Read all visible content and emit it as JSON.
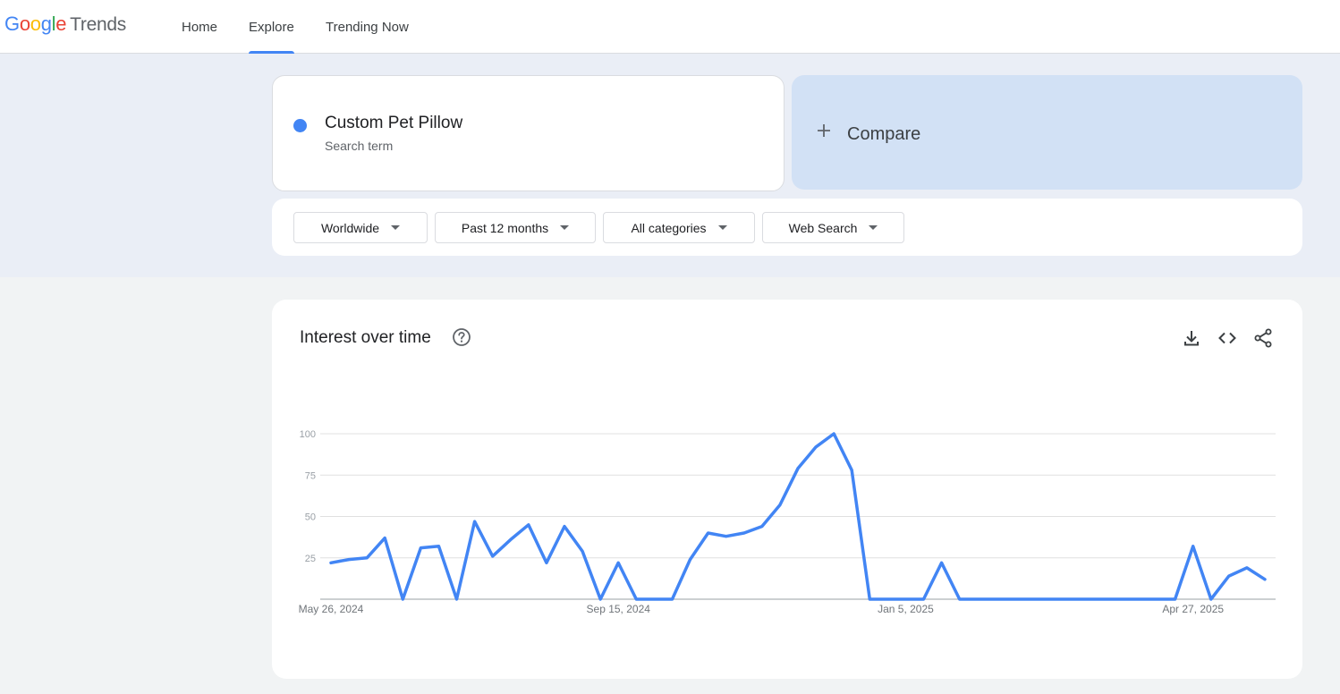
{
  "header": {
    "logo_google": "Google",
    "logo_trends": "Trends",
    "nav": [
      {
        "label": "Home"
      },
      {
        "label": "Explore"
      },
      {
        "label": "Trending Now"
      }
    ]
  },
  "search_term": {
    "name": "Custom Pet Pillow",
    "sub": "Search term",
    "color": "#4285f4"
  },
  "compare": {
    "label": "Compare"
  },
  "filters": {
    "region": "Worldwide",
    "time": "Past 12 months",
    "category": "All categories",
    "source": "Web Search"
  },
  "chart_section": {
    "title": "Interest over time",
    "icons": [
      "help-icon",
      "download-icon",
      "embed-icon",
      "share-icon"
    ]
  },
  "chart_data": {
    "type": "line",
    "title": "Interest over time",
    "xlabel": "",
    "ylabel": "",
    "ylim": [
      0,
      100
    ],
    "yticks": [
      25,
      50,
      75,
      100
    ],
    "x_tick_labels": [
      {
        "label": "May 26, 2024",
        "index": 0
      },
      {
        "label": "Sep 15, 2024",
        "index": 16
      },
      {
        "label": "Jan 5, 2025",
        "index": 32
      },
      {
        "label": "Apr 27, 2025",
        "index": 48
      }
    ],
    "grid": true,
    "series": [
      {
        "color": "#4285f4",
        "values": [
          22,
          24,
          25,
          37,
          0,
          31,
          32,
          0,
          47,
          26,
          36,
          45,
          22,
          44,
          29,
          0,
          22,
          0,
          0,
          0,
          24,
          40,
          38,
          40,
          44,
          57,
          79,
          92,
          100,
          78,
          0,
          0,
          0,
          0,
          22,
          0,
          0,
          0,
          0,
          0,
          0,
          0,
          0,
          0,
          0,
          0,
          0,
          0,
          32,
          0,
          14,
          19,
          12
        ]
      }
    ]
  }
}
